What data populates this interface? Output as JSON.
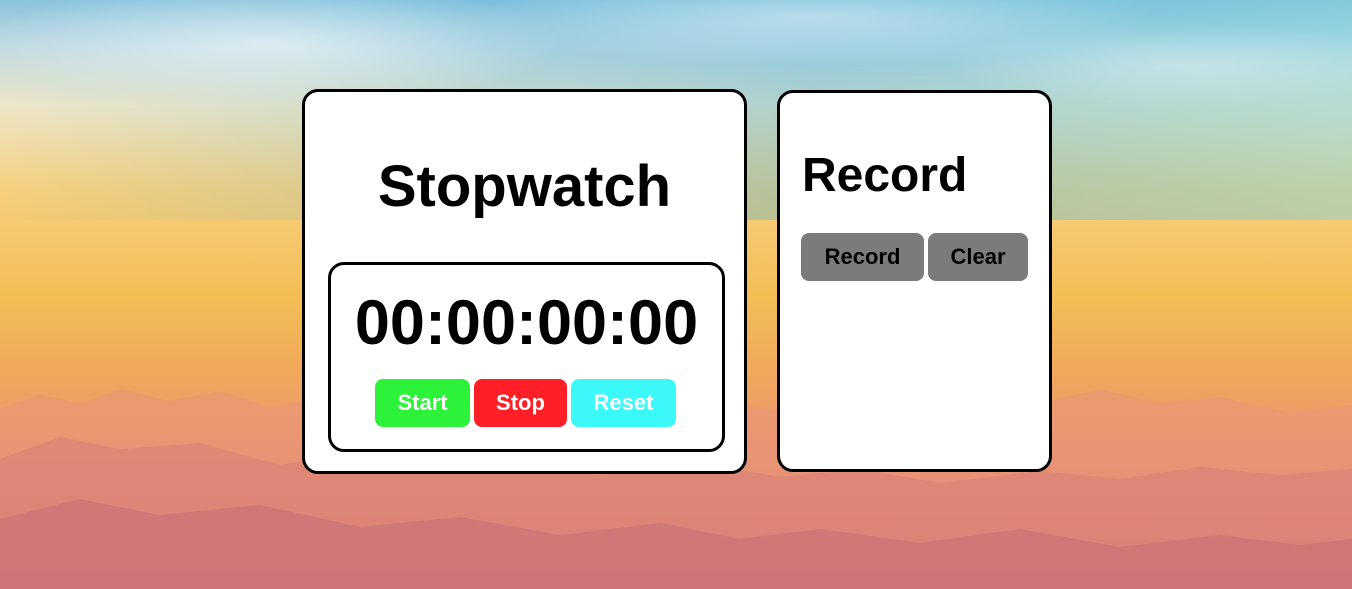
{
  "stopwatch": {
    "title": "Stopwatch",
    "time": "00:00:00:00",
    "buttons": {
      "start": "Start",
      "stop": "Stop",
      "reset": "Reset"
    }
  },
  "record": {
    "title": "Record",
    "buttons": {
      "record": "Record",
      "clear": "Clear"
    },
    "entries": []
  },
  "colors": {
    "start": "#2cf23a",
    "stop": "#ff1f26",
    "reset": "#3cf9f9",
    "record_buttons": "#7b7b7b"
  }
}
